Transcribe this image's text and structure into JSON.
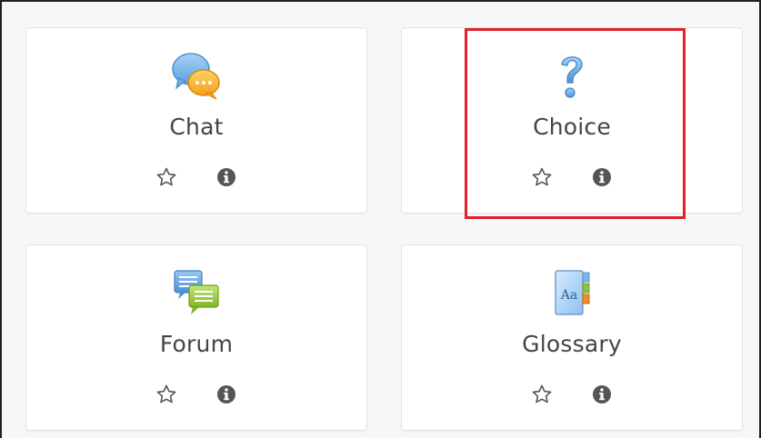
{
  "activities": [
    {
      "label": "Chat",
      "icon": "chat-icon",
      "star_icon": "star-outline-icon",
      "info_icon": "info-icon"
    },
    {
      "label": "Choice",
      "icon": "question-icon",
      "star_icon": "star-outline-icon",
      "info_icon": "info-icon"
    },
    {
      "label": "Forum",
      "icon": "forum-icon",
      "star_icon": "star-outline-icon",
      "info_icon": "info-icon"
    },
    {
      "label": "Glossary",
      "icon": "glossary-icon",
      "star_icon": "star-outline-icon",
      "info_icon": "info-icon"
    }
  ],
  "colors": {
    "highlight": "#e0202a",
    "text": "#444444",
    "card_border": "#e3e3e3",
    "icon_dark": "#555555"
  }
}
